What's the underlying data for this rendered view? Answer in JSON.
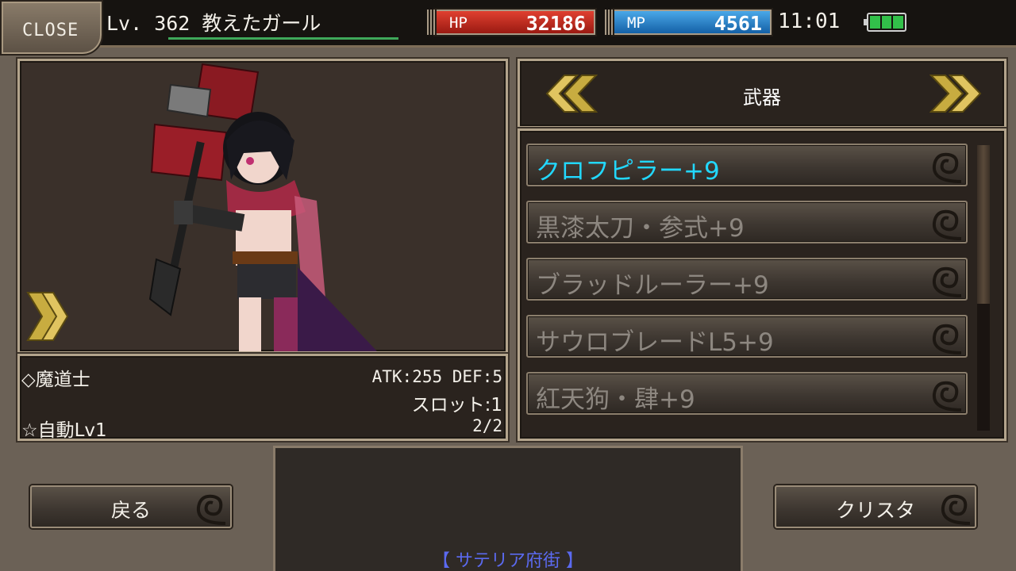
{
  "header": {
    "close_label": "CLOSE",
    "player_label": "Lv. 362 教えたガール",
    "hp_label": "HP",
    "hp_value": "32186",
    "mp_label": "MP",
    "mp_value": "4561",
    "time": "11:01",
    "battery_cells": 3
  },
  "character": {
    "job": "◇魔道士",
    "stats": "ATK:255 DEF:5",
    "slot": "スロット:1",
    "auto_skill": "☆自動Lv1",
    "page": "2/2"
  },
  "equipment": {
    "category": "武器",
    "items": [
      {
        "label": "クロフピラー+9"
      },
      {
        "label": "黒漆太刀・参式+9"
      },
      {
        "label": "ブラッドルーラー+9"
      },
      {
        "label": "サウロブレードL5+9"
      },
      {
        "label": "紅天狗・肆+9"
      }
    ]
  },
  "buttons": {
    "back": "戻る",
    "crysta": "クリスタ"
  },
  "message": {
    "location": "【 サテリア府街 】"
  },
  "colors": {
    "selected_item": "#22d8ff",
    "unselected_item": "#8d8780",
    "hp": "#c8281c",
    "mp": "#2a7fcc",
    "location_text": "#5b6af0"
  }
}
